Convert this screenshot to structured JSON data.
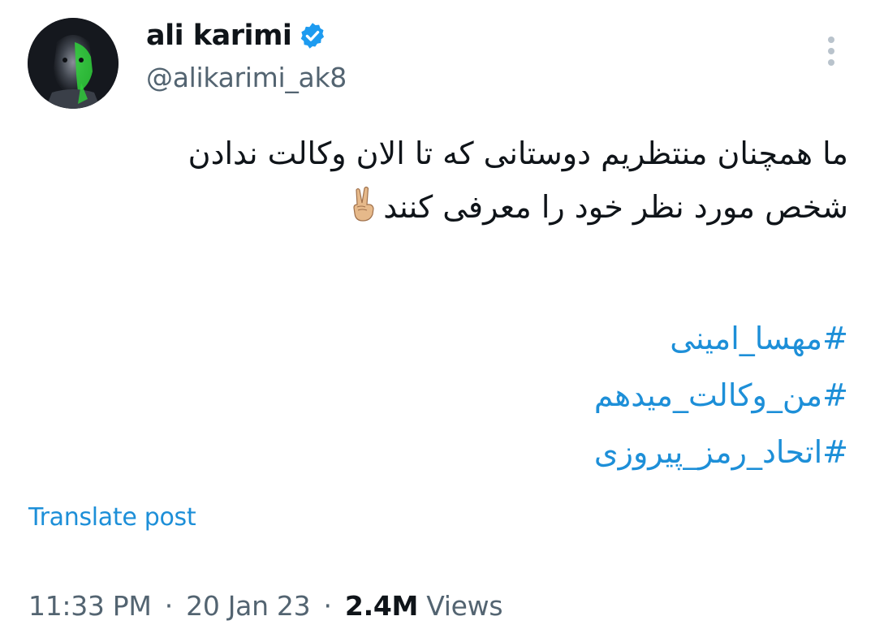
{
  "author": {
    "display_name": "ali karimi",
    "handle": "@alikarimi_ak8",
    "verified": true,
    "verified_color": "#1d9bf0",
    "avatar_icon": "profile-photo"
  },
  "menu": {
    "icon": "more-vertical-icon"
  },
  "tweet": {
    "lines": [
      "ما همچنان منتظریم دوستانی که تا الان وکالت ندادن",
      "شخص مورد نظر خود را معرفی کنند"
    ],
    "emoji": "✌🏼",
    "emoji_name": "victory-hand-icon",
    "hashtags": [
      "#مهسا_امینی",
      "#من_وکالت_میدهم",
      "#اتحاد_رمز_پیروزی"
    ],
    "link_color": "#1d8fd8"
  },
  "translate_label": "Translate post",
  "meta": {
    "time": "11:33 PM",
    "separator": "·",
    "date": "20 Jan 23",
    "views_count": "2.4M",
    "views_label": "Views"
  }
}
